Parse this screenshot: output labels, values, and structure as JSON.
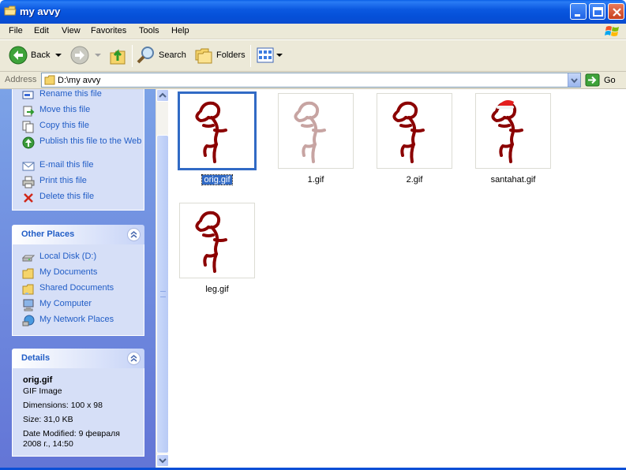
{
  "window": {
    "title": "my avvy"
  },
  "menu": [
    "File",
    "Edit",
    "View",
    "Favorites",
    "Tools",
    "Help"
  ],
  "toolbar": {
    "back": "Back",
    "search": "Search",
    "folders": "Folders"
  },
  "address": {
    "label": "Address",
    "path": "D:\\my avvy",
    "go": "Go"
  },
  "file_tasks": [
    "Rename this file",
    "Move this file",
    "Copy this file",
    "Publish this file to the Web",
    "E-mail this file",
    "Print this file",
    "Delete this file"
  ],
  "other_places": {
    "title": "Other Places",
    "items": [
      "Local Disk (D:)",
      "My Documents",
      "Shared Documents",
      "My Computer",
      "My Network Places"
    ]
  },
  "details": {
    "title": "Details",
    "name": "orig.gif",
    "type": "GIF Image",
    "dimensions": "Dimensions: 100 x 98",
    "size": "Size: 31,0 KB",
    "modified": "Date Modified: 9 февраля 2008 г., 14:50"
  },
  "files": [
    {
      "name": "orig.gif",
      "selected": true,
      "color": "#8b0000"
    },
    {
      "name": "1.gif",
      "selected": false,
      "color": "#c7a4a2"
    },
    {
      "name": "2.gif",
      "selected": false,
      "color": "#8b0000"
    },
    {
      "name": "santahat.gif",
      "selected": false,
      "color": "#8b0000",
      "hat": true
    },
    {
      "name": "leg.gif",
      "selected": false,
      "color": "#8b0000"
    }
  ],
  "colors": {
    "title_bar": "#0a58e0",
    "link": "#215dc6",
    "selection": "#316ac5"
  }
}
